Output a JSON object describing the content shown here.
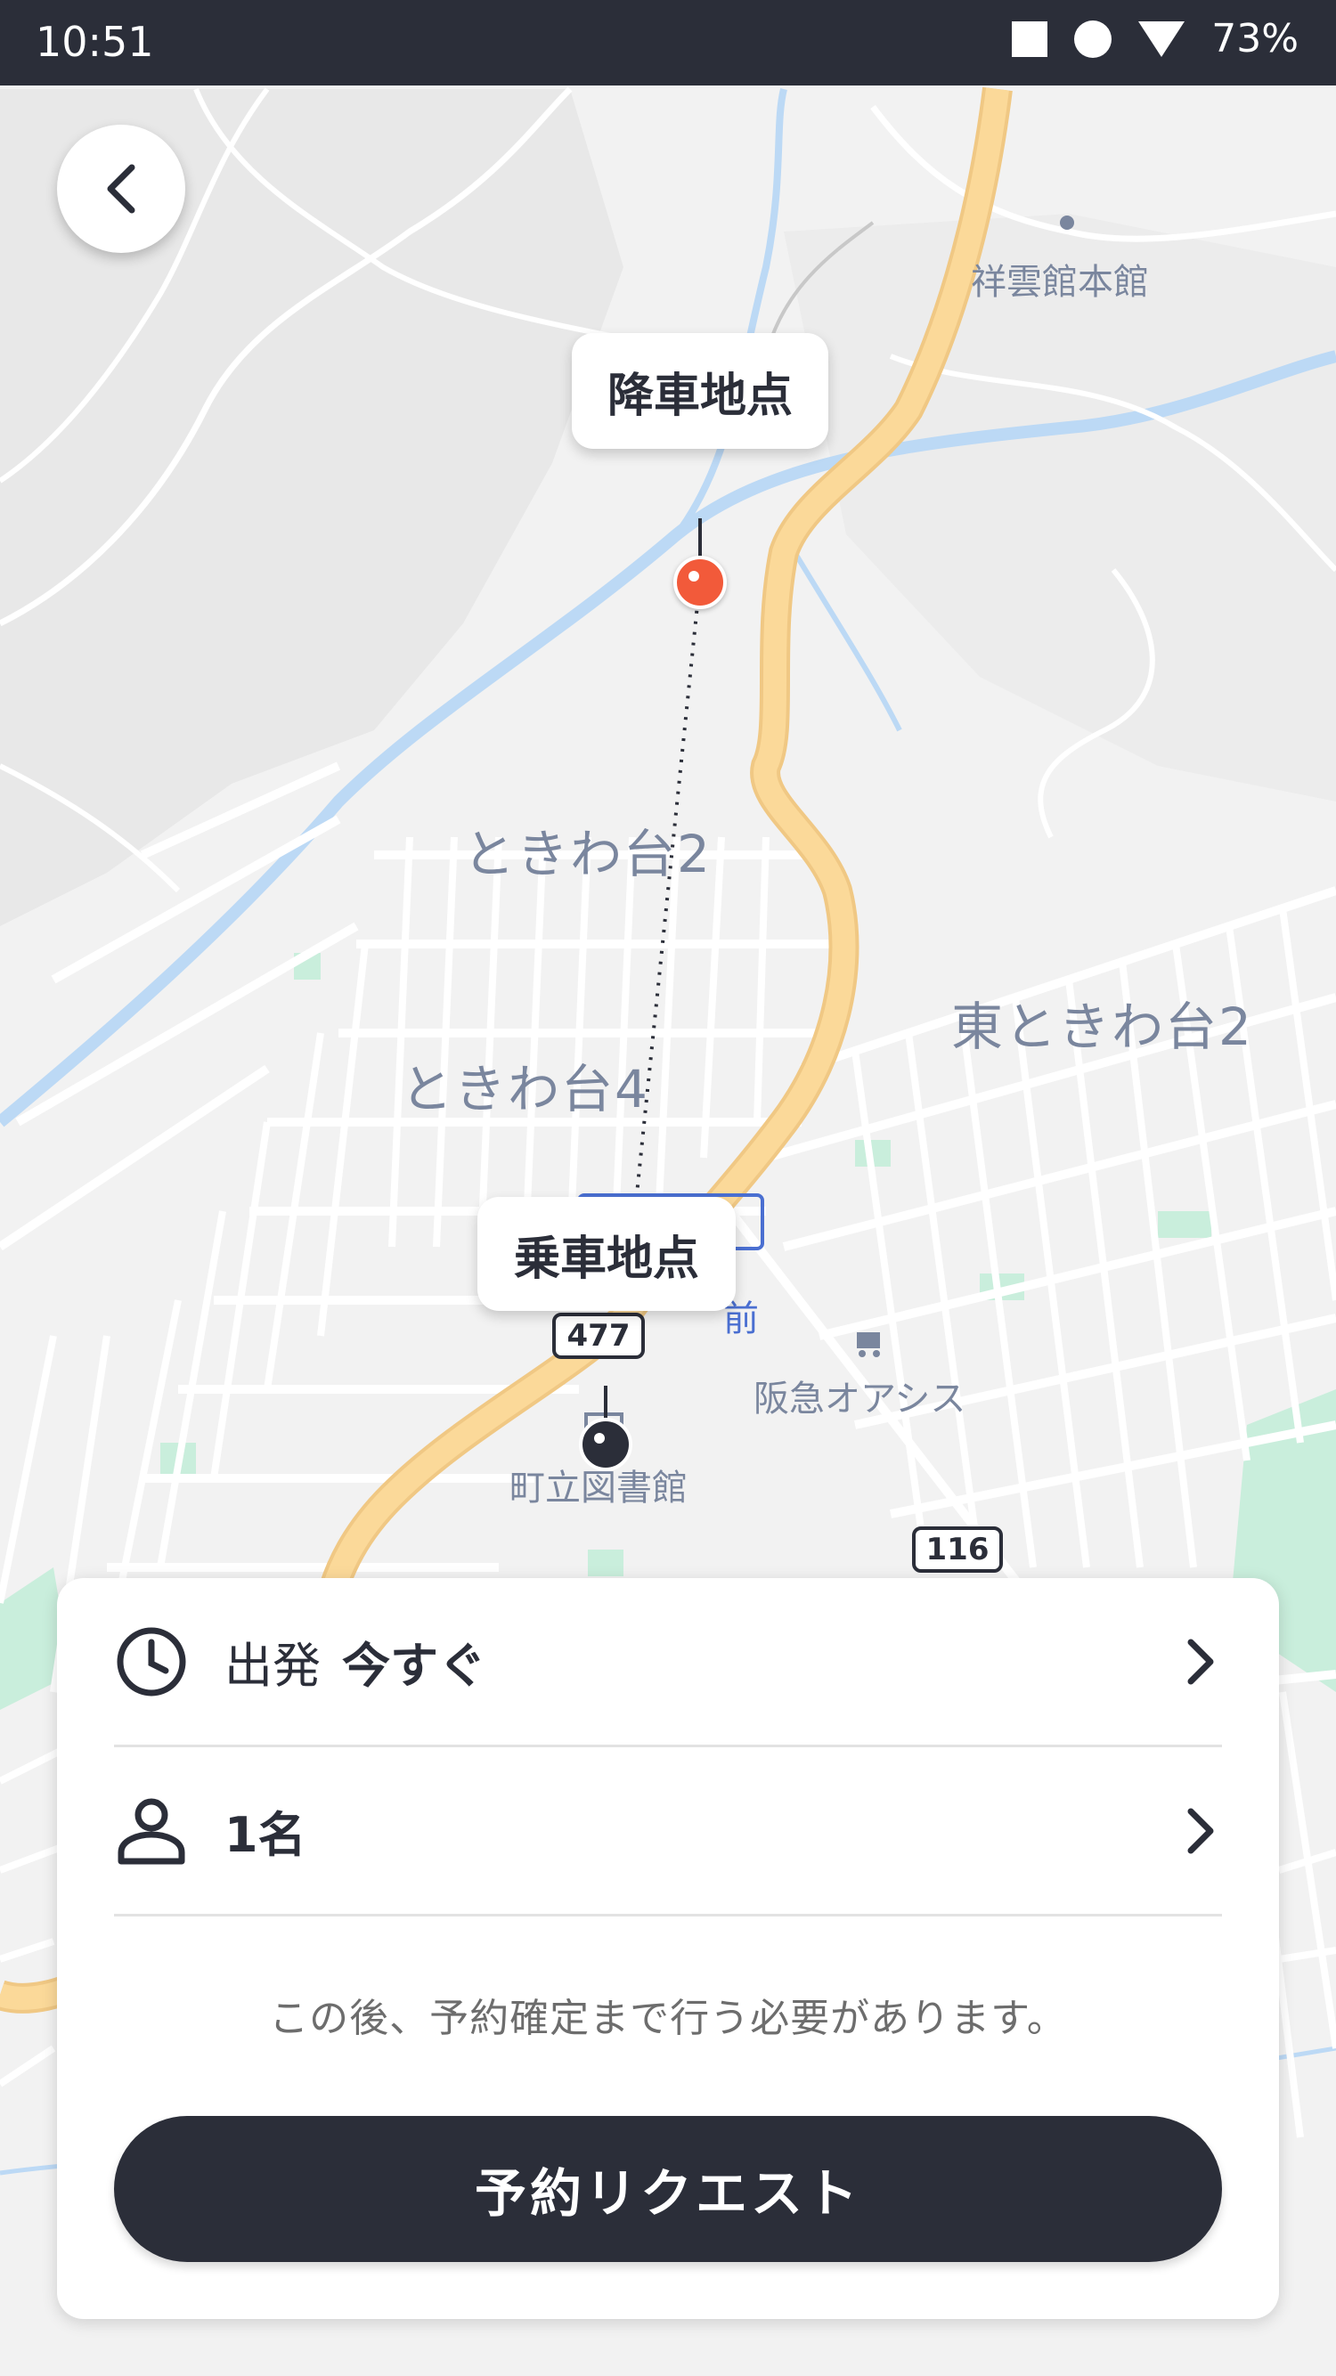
{
  "status_bar": {
    "time": "10:51",
    "battery": "73%",
    "icons": [
      "stop-square-icon",
      "record-circle-icon",
      "wifi-icon"
    ]
  },
  "map": {
    "area_labels": [
      "ときわ台2",
      "ときわ台4",
      "東ときわ台2"
    ],
    "poi_labels": [
      "祥雲館本館",
      "阪急オアシス",
      "町立図書館"
    ],
    "route_shields": [
      "477",
      "116"
    ],
    "partial_label": "前",
    "colors": {
      "road_major": "#fbd999",
      "water": "#bcd9f5",
      "park": "#c9eedc"
    }
  },
  "dropoff": {
    "label": "降車地点",
    "color": "#f25a3a"
  },
  "pickup": {
    "label": "乗車地点",
    "color": "#2b2e39"
  },
  "panel": {
    "departure_label": "出発",
    "departure_value": "今すぐ",
    "passengers": "1名",
    "notice": "この後、予約確定まで行う必要があります。",
    "cta": "予約リクエスト"
  }
}
